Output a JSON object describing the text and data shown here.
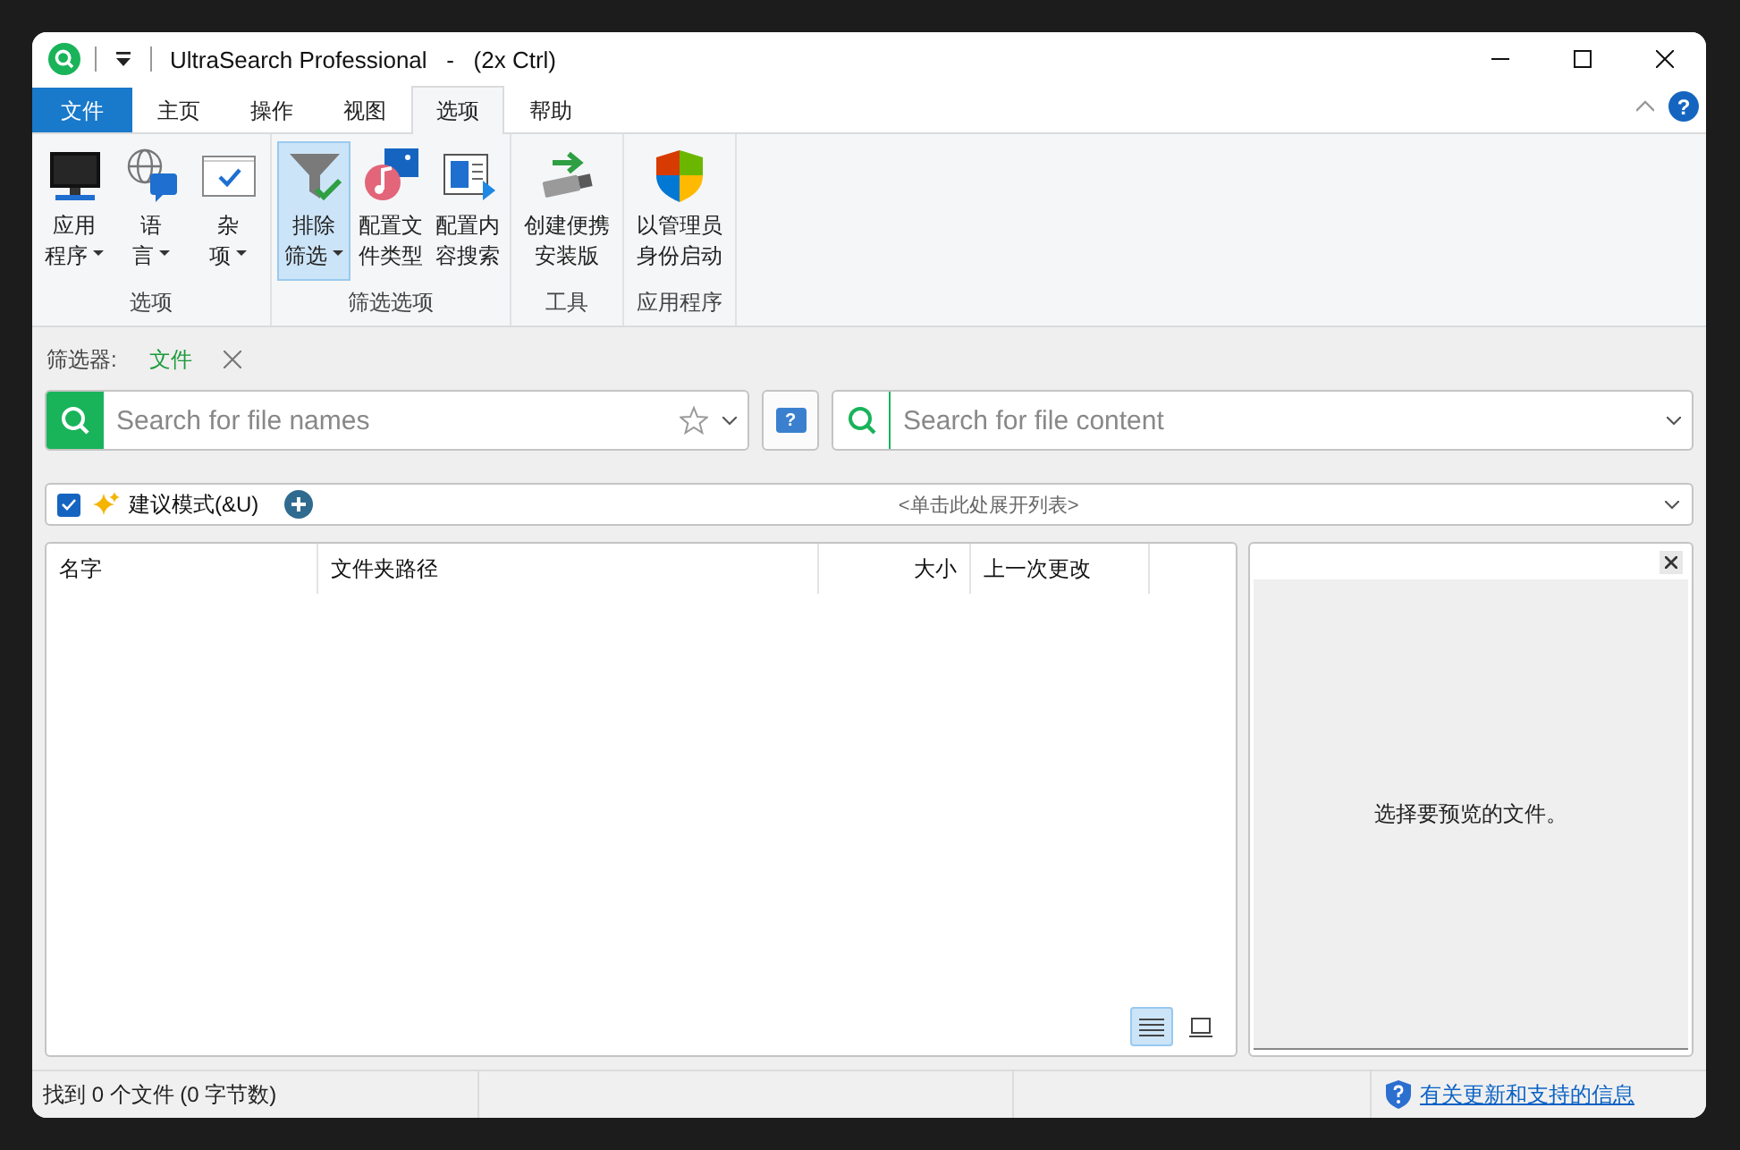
{
  "window": {
    "title": "UltraSearch Professional   -   (2x Ctrl)"
  },
  "menu_tabs": [
    {
      "label": "文件",
      "kind": "file",
      "selected": false
    },
    {
      "label": "主页",
      "kind": "tab",
      "selected": false
    },
    {
      "label": "操作",
      "kind": "tab",
      "selected": false
    },
    {
      "label": "视图",
      "kind": "tab",
      "selected": false
    },
    {
      "label": "选项",
      "kind": "tab",
      "selected": true
    },
    {
      "label": "帮助",
      "kind": "tab",
      "selected": false
    }
  ],
  "ribbon_help": {
    "glyph": "?"
  },
  "ribbon_groups": [
    {
      "label": "选项",
      "buttons": [
        {
          "lines": [
            "应用",
            "程序"
          ],
          "kind": "monitor",
          "dropdown": true,
          "pressed": false
        },
        {
          "lines": [
            "语",
            "言"
          ],
          "kind": "globe",
          "dropdown": true,
          "pressed": false
        },
        {
          "lines": [
            "杂",
            "项"
          ],
          "kind": "checkwindow",
          "dropdown": true,
          "pressed": false
        }
      ]
    },
    {
      "label": "筛选选项",
      "buttons": [
        {
          "lines": [
            "排除",
            "筛选"
          ],
          "kind": "funnel",
          "dropdown": true,
          "pressed": true
        },
        {
          "lines": [
            "配置文",
            "件类型"
          ],
          "kind": "music",
          "dropdown": false,
          "pressed": false
        },
        {
          "lines": [
            "配置内",
            "容搜索"
          ],
          "kind": "document",
          "dropdown": false,
          "pressed": false
        }
      ]
    },
    {
      "label": "工具",
      "buttons": [
        {
          "lines": [
            "创建便携",
            "安装版"
          ],
          "kind": "usb",
          "dropdown": false,
          "pressed": false
        }
      ]
    },
    {
      "label": "应用程序",
      "buttons": [
        {
          "lines": [
            "以管理员",
            "身份启动"
          ],
          "kind": "shield",
          "dropdown": false,
          "pressed": false
        }
      ]
    }
  ],
  "filter": {
    "label": "筛选器:",
    "value": "文件"
  },
  "name_search": {
    "placeholder": "Search for file names"
  },
  "help_button": {
    "glyph": "?"
  },
  "content_search": {
    "placeholder": "Search for file content"
  },
  "suggest": {
    "checked": true,
    "label": "建议模式(&U)",
    "hint": "<单击此处展开列表>"
  },
  "table": {
    "columns": [
      "名字",
      "文件夹路径",
      "大小",
      "上一次更改"
    ]
  },
  "view_modes": [
    {
      "kind": "details",
      "selected": true
    },
    {
      "kind": "preview",
      "selected": false
    }
  ],
  "preview": {
    "message": "选择要预览的文件。"
  },
  "status_bar": {
    "text": "找到 0 个文件 (0 字节数)",
    "link": "有关更新和支持的信息"
  }
}
